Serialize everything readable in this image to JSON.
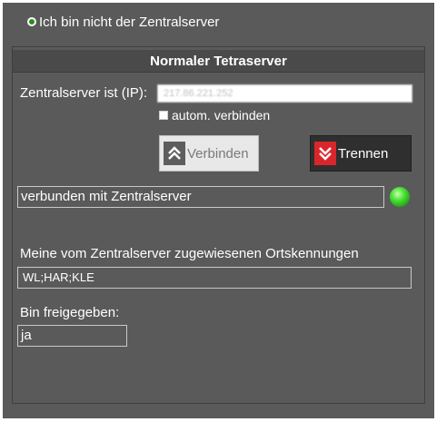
{
  "mode_radio": {
    "label": "Ich bin nicht der Zentralserver",
    "selected": true
  },
  "panel": {
    "title": "Normaler Tetraserver",
    "ip_label": "Zentralserver ist (IP):",
    "ip_value": "217.86.221.252",
    "auto_connect_label": "autom. verbinden",
    "connect_button": "Verbinden",
    "disconnect_button": "Trennen",
    "status_text": "verbunden mit Zentralserver",
    "status_color": "#3ed12c",
    "codes_label": "Meine vom Zentralserver zugewiesenen Ortskennungen",
    "codes_value": "WL;HAR;KLE",
    "released_label": "Bin freigegeben:",
    "released_value": "ja"
  },
  "icons": {
    "connect": "double-chevron-up-icon",
    "disconnect": "double-chevron-down-icon",
    "status": "status-led-icon"
  }
}
